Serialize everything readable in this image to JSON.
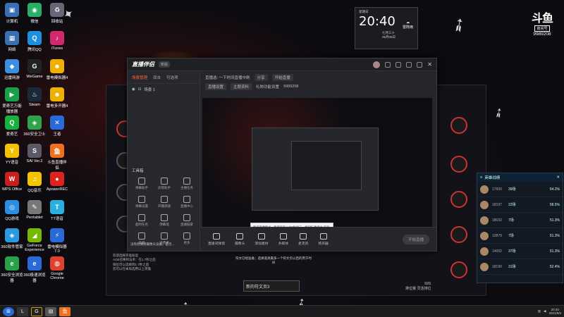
{
  "desktop_icons": [
    {
      "label": "计算机",
      "color": "#3b6fb5",
      "glyph": "▣"
    },
    {
      "label": "微信",
      "color": "#2aae67",
      "glyph": "◉"
    },
    {
      "label": "回收站",
      "color": "#667",
      "glyph": "♻"
    },
    {
      "label": "网络",
      "color": "#3a6fb0",
      "glyph": "▦"
    },
    {
      "label": "腾讯QQ",
      "color": "#1d8fe0",
      "glyph": "Q"
    },
    {
      "label": "iTunes",
      "color": "#d2286e",
      "glyph": "♪"
    },
    {
      "label": "迅雷网游",
      "color": "#3a8fe0",
      "glyph": "◆"
    },
    {
      "label": "WeGame",
      "color": "#222",
      "glyph": "G"
    },
    {
      "label": "雷电模拟器4",
      "color": "#f0b000",
      "glyph": "☻"
    },
    {
      "label": "爱奇艺万能播放器",
      "color": "#1aa04a",
      "glyph": "▶"
    },
    {
      "label": "Steam",
      "color": "#1b2838",
      "glyph": "♨"
    },
    {
      "label": "雷电多开器4",
      "color": "#f0b000",
      "glyph": "☻"
    },
    {
      "label": "爱奇艺",
      "color": "#16b13f",
      "glyph": "Q"
    },
    {
      "label": "360安全卫士",
      "color": "#2fa34c",
      "glyph": "◈"
    },
    {
      "label": "王者",
      "color": "#2a6ad8",
      "glyph": "✕"
    },
    {
      "label": "YY语音",
      "color": "#f2c200",
      "glyph": "Y"
    },
    {
      "label": "SAI Ver.2",
      "color": "#5a5a66",
      "glyph": "S"
    },
    {
      "label": "斗鱼直播伴侣",
      "color": "#f07020",
      "glyph": "鱼"
    },
    {
      "label": "WPS Office",
      "color": "#c81e1e",
      "glyph": "W"
    },
    {
      "label": "QQ音乐",
      "color": "#f5c400",
      "glyph": "♫"
    },
    {
      "label": "ApowerREC",
      "color": "#d22",
      "glyph": "●"
    },
    {
      "label": "QQ游戏",
      "color": "#2a8fe0",
      "glyph": "◎"
    },
    {
      "label": "Pentablet",
      "color": "#777",
      "glyph": "✎"
    },
    {
      "label": "TT语音",
      "color": "#2ab0e0",
      "glyph": "T"
    },
    {
      "label": "360软件管家",
      "color": "#2a9ae0",
      "glyph": "◈"
    },
    {
      "label": "GeForce Experience",
      "color": "#76b900",
      "glyph": "◢"
    },
    {
      "label": "雷电模拟器7.0",
      "color": "#2a6ad8",
      "glyph": "⚡"
    },
    {
      "label": "360安全浏览器",
      "color": "#2aa04a",
      "glyph": "e"
    },
    {
      "label": "360极速浏览器",
      "color": "#2a6ad8",
      "glyph": "e"
    },
    {
      "label": "Google Chrome",
      "color": "#e04030",
      "glyph": "◍"
    }
  ],
  "clock_widget": {
    "label": "星期日",
    "time": "20:40",
    "date": "七月三十",
    "date2": "06月06日",
    "weather": "雷阵雨"
  },
  "douyu": {
    "logo": "斗鱼",
    "room_label": "房间号",
    "room_number": "9989208"
  },
  "app": {
    "title": "直播伴侣",
    "version_badge": "新版",
    "left_tabs": [
      "场景管理",
      "双击",
      "可选项"
    ],
    "scene_name": "场景 1",
    "tools_title": "工具箱",
    "tools": [
      "弹幕助手",
      "房管助手",
      "主播任务",
      "弹幕设置",
      "开播测速",
      "直播中心",
      "超时任务",
      "弹幕墙",
      "直播鼓掌",
      "美颜",
      "消费者",
      "更多"
    ],
    "preview_info": [
      "直播选: 一下时间直播中刷",
      "分享",
      "开始直播"
    ],
    "preview_info2": [
      "直播设置",
      "主题资料",
      "礼物功能设置",
      "9989208"
    ],
    "camera_tip": "没有检测到摄像头设备，是否...",
    "bottom_actions": [
      "直播间弹窗",
      "摄像头",
      "添加素材",
      "多媒体",
      "麦克风",
      "扬声器"
    ],
    "start_button": "开始直播",
    "tooltip": "暂停直播模式，暂停画面上方5秒显示，将鼠标悬停在 画面上的任何位置，就可以直接刷新画面请按Ctrl+V粘贴文本/图片"
  },
  "rank_panel": {
    "title": "英雄战绩",
    "rows": [
      {
        "score": "17500",
        "games": "39场",
        "win": "54.2%"
      },
      {
        "score": "18197",
        "games": "22场",
        "win": "58.5%"
      },
      {
        "score": "18032",
        "games": "7场",
        "win": "51.3%"
      },
      {
        "score": "12879",
        "games": "7场",
        "win": "51.3%"
      },
      {
        "score": "14002",
        "games": "37场",
        "win": "51.3%"
      },
      {
        "score": "18190",
        "games": "31场",
        "win": "52.4%"
      }
    ]
  },
  "game": {
    "input_text": "新的符文页3",
    "prompt_text": "符文已经准备；选择道具最多一个符文页以后的用于时间",
    "note_lines": [
      "欢迎选择英雄联盟",
      "AOE召唤师法术：在1.7秒之后",
      "排位可以选择到1.7秒之后",
      "您可以在本局选用以上英雄"
    ],
    "right_label": "S9S",
    "right_sub": "排位赛 灵活排位"
  },
  "taskbar": {
    "time": "20:40",
    "date": "2021/6/6"
  }
}
